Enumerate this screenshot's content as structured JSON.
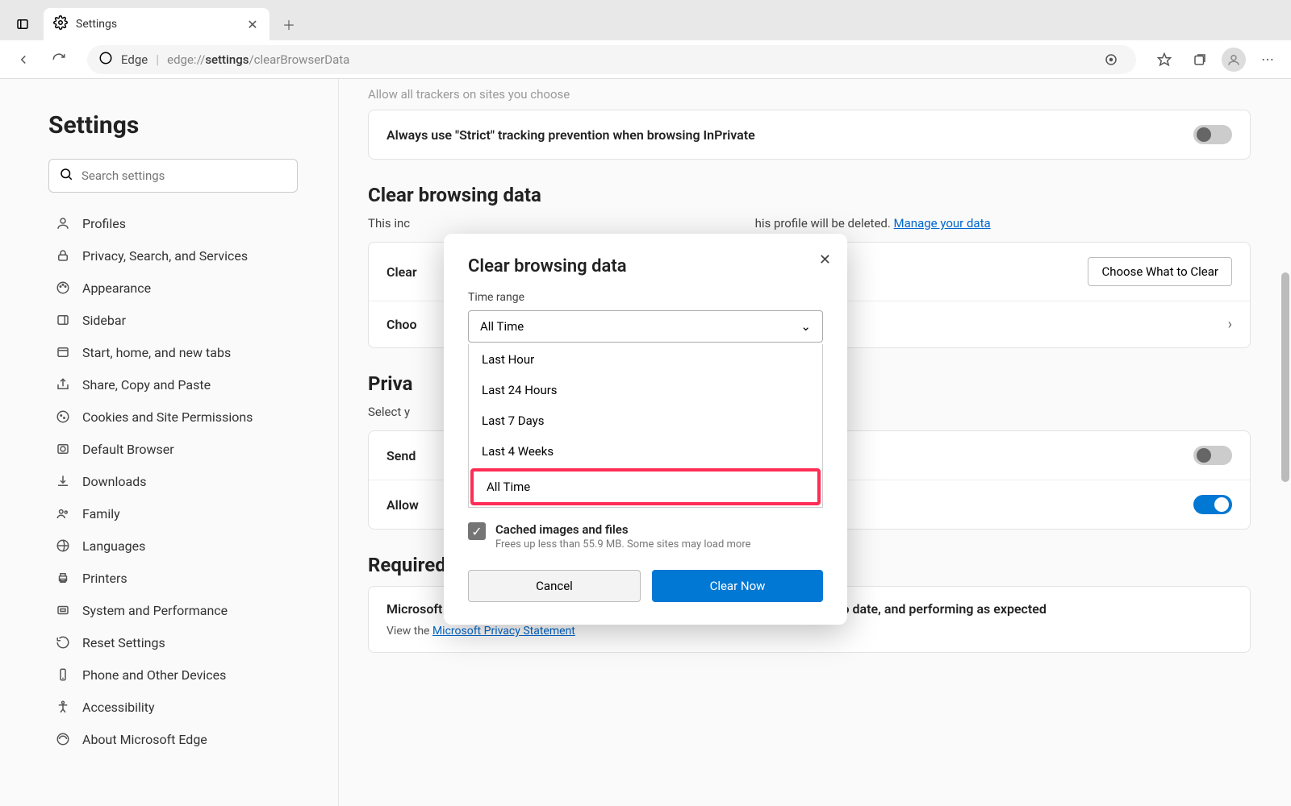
{
  "tab": {
    "title": "Settings"
  },
  "address": {
    "label": "Edge",
    "prefix": "edge://",
    "bold": "settings",
    "suffix": "/clearBrowserData"
  },
  "sidebar": {
    "heading": "Settings",
    "search_placeholder": "Search settings",
    "items": [
      "Profiles",
      "Privacy, Search, and Services",
      "Appearance",
      "Sidebar",
      "Start, home, and new tabs",
      "Share, Copy and Paste",
      "Cookies and Site Permissions",
      "Default Browser",
      "Downloads",
      "Family",
      "Languages",
      "Printers",
      "System and Performance",
      "Reset Settings",
      "Phone and Other Devices",
      "Accessibility",
      "About Microsoft Edge"
    ]
  },
  "main": {
    "faded_line": "Allow all trackers on sites you choose",
    "strict_label": "Always use \"Strict\" tracking prevention when browsing InPrivate",
    "clear_heading": "Clear browsing data",
    "clear_desc_prefix": "This inc",
    "clear_desc_suffix": "his profile will be deleted. ",
    "manage_link": "Manage your data",
    "clear_now_label": "Clear",
    "choose_btn": "Choose What to Clear",
    "choose_close_label": "Choo",
    "privacy_heading": "Priva",
    "privacy_desc": "Select y",
    "send_label": "Send",
    "allow_label": "Allow",
    "required_heading": "Required diagnostic data",
    "required_desc": "Microsoft collects required diagnostic data to keep Microsoft Edge secure, up to date, and performing as expected",
    "view_prefix": "View the ",
    "privacy_link": "Microsoft Privacy Statement"
  },
  "modal": {
    "title": "Clear browsing data",
    "time_label": "Time range",
    "selected": "All Time",
    "options": [
      "Last Hour",
      "Last 24 Hours",
      "Last 7 Days",
      "Last 4 Weeks",
      "All Time"
    ],
    "highlight_index": 4,
    "cb_label": "Cached images and files",
    "cb_sub": "Frees up less than 55.9 MB. Some sites may load more",
    "cancel": "Cancel",
    "clear": "Clear Now"
  }
}
